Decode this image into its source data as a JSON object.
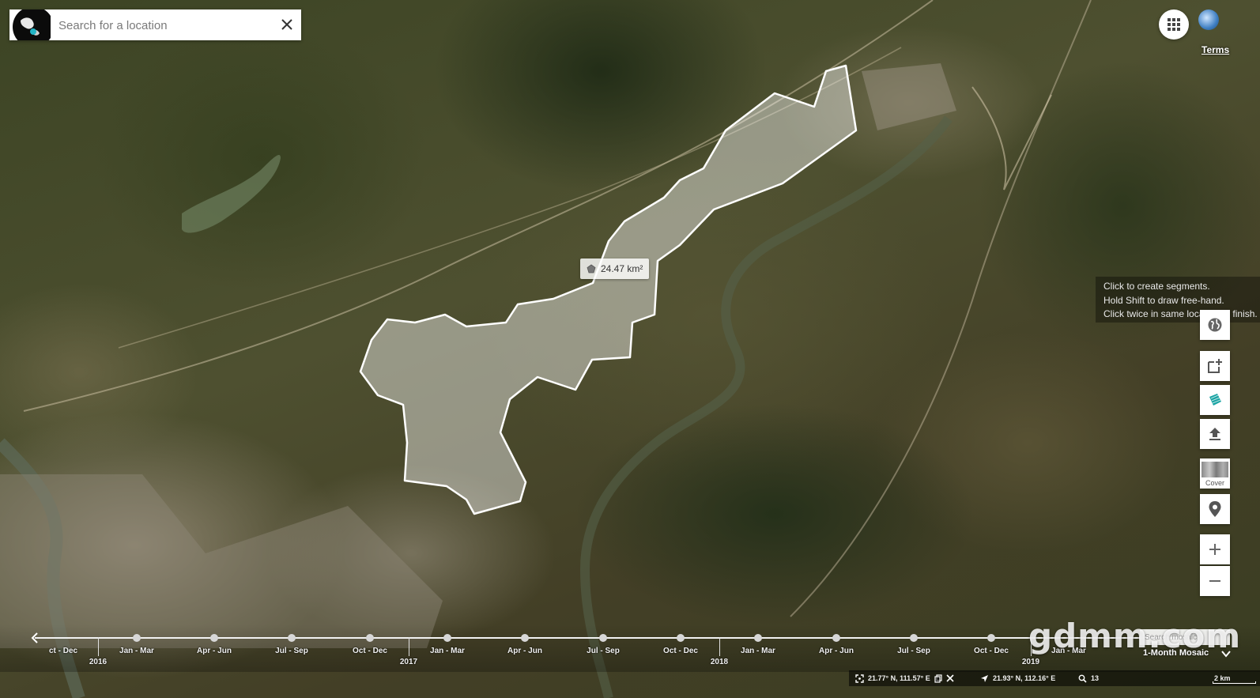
{
  "search": {
    "placeholder": "Search for a location"
  },
  "header": {
    "terms_label": "Terms"
  },
  "area_measurement": {
    "value_label": "24.47 km²"
  },
  "draw_help": {
    "lines": [
      "Click to create segments.",
      "Hold Shift to draw free-hand.",
      "Click twice in same location to finish."
    ]
  },
  "toolbar": {
    "cover_label": "Cover",
    "icons": [
      "globe-icon",
      "add-feature-icon",
      "layers-icon",
      "upload-icon",
      "cover-thumbnail",
      "location-pin-icon",
      "zoom-in-icon",
      "zoom-out-icon"
    ]
  },
  "timeline": {
    "quarter_labels": [
      "ct - Dec",
      "Jan - Mar",
      "Apr - Jun",
      "Jul - Sep",
      "Oct - Dec",
      "Jan - Mar",
      "Apr - Jun",
      "Jul - Sep",
      "Oct - Dec",
      "Jan - Mar",
      "Apr - Jun",
      "Jul - Sep",
      "Oct - Dec",
      "Jan - Mar"
    ],
    "year_labels": [
      "2016",
      "2017",
      "2018",
      "2019"
    ],
    "mosaic_search_placeholder": "Search mosaic",
    "mosaic_selected": "1-Month Mosaic"
  },
  "watermark": {
    "text": "gdmm.com"
  },
  "status_bar": {
    "view_center": "21.77° N, 111.57° E",
    "cursor": "21.93° N, 112.16° E",
    "zoom": "13",
    "scale": "2 km"
  },
  "colors": {
    "polygon_fill": "#ffffff",
    "polygon_stroke": "#ffffff",
    "layers_icon_accent": "#1aa4a4"
  }
}
